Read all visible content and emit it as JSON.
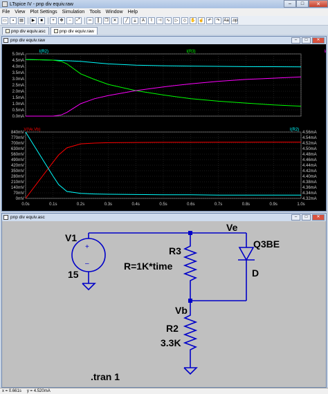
{
  "window": {
    "title": "LTspice IV - pnp div equiv.raw",
    "min": "–",
    "max": "□",
    "close": "✕"
  },
  "menu": [
    "File",
    "View",
    "Plot Settings",
    "Simulation",
    "Tools",
    "Window",
    "Help"
  ],
  "tabs": [
    {
      "label": "pnp div equiv.asc"
    },
    {
      "label": "pnp div equiv.raw"
    }
  ],
  "plot_window": {
    "title": "pnp div equiv.raw",
    "colors": {
      "ir2": "#00ffff",
      "ir3": "#00ff00",
      "iq3be": "#ff00ff",
      "vdiff": "#ff0000",
      "grid": "#3a3a3a",
      "axis_text": "#d0d0d0"
    }
  },
  "chart_data": [
    {
      "type": "line",
      "pane": "top",
      "legend": [
        "I(R2)",
        "I(R3)",
        "I(Q3be)"
      ],
      "y_ticks": [
        "5.0mA",
        "4.5mA",
        "4.0mA",
        "3.5mA",
        "3.0mA",
        "2.5mA",
        "2.0mA",
        "1.5mA",
        "1.0mA",
        "0.5mA",
        "0.0mA"
      ],
      "ylim": [
        0,
        5.0
      ],
      "yunit": "mA",
      "xlim": [
        0,
        1.0
      ],
      "x": [
        0,
        0.05,
        0.1,
        0.13,
        0.15,
        0.2,
        0.25,
        0.3,
        0.4,
        0.5,
        0.6,
        0.7,
        0.8,
        0.9,
        1.0
      ],
      "series": [
        {
          "name": "I(R2)",
          "values": [
            4.55,
            4.53,
            4.5,
            4.47,
            4.45,
            4.4,
            4.3,
            4.2,
            4.1,
            4.05,
            4.02,
            4.0,
            3.98,
            3.97,
            3.96
          ]
        },
        {
          "name": "I(R3)",
          "values": [
            4.55,
            4.53,
            4.5,
            4.4,
            4.2,
            3.4,
            2.95,
            2.55,
            2.05,
            1.7,
            1.4,
            1.2,
            1.05,
            0.9,
            0.8
          ]
        },
        {
          "name": "I(Q3be)",
          "values": [
            0.0,
            0.0,
            0.0,
            0.1,
            0.3,
            1.0,
            1.4,
            1.65,
            2.05,
            2.35,
            2.6,
            2.8,
            2.95,
            3.05,
            3.15
          ]
        }
      ]
    },
    {
      "type": "line",
      "pane": "bottom",
      "legend": [
        "V(Ve,Vb)",
        "I(R2)"
      ],
      "y_ticks_left": [
        "840mV",
        "770mV",
        "700mV",
        "630mV",
        "560mV",
        "490mV",
        "420mV",
        "350mV",
        "280mV",
        "210mV",
        "140mV",
        "70mV",
        "0mV"
      ],
      "y_ticks_right": [
        "4.56mA",
        "4.54mA",
        "4.52mA",
        "4.50mA",
        "4.48mA",
        "4.46mA",
        "4.44mA",
        "4.42mA",
        "4.40mA",
        "4.38mA",
        "4.36mA",
        "4.34mA",
        "4.32mA"
      ],
      "ylim_left": [
        0,
        840
      ],
      "ylim_right": [
        4.32,
        4.56
      ],
      "x_ticks": [
        "0.0s",
        "0.1s",
        "0.2s",
        "0.3s",
        "0.4s",
        "0.5s",
        "0.6s",
        "0.7s",
        "0.8s",
        "0.9s",
        "1.0s"
      ],
      "xlim": [
        0,
        1.0
      ],
      "x": [
        0,
        0.05,
        0.1,
        0.12,
        0.15,
        0.2,
        0.25,
        0.3,
        0.4,
        0.5,
        0.6,
        0.7,
        0.8,
        0.9,
        1.0
      ],
      "series": [
        {
          "name": "V(Ve,Vb)",
          "axis": "left",
          "values": [
            0,
            230,
            460,
            550,
            640,
            690,
            700,
            705,
            708,
            710,
            710,
            711,
            711,
            712,
            712
          ]
        },
        {
          "name": "I(R2)",
          "axis": "right",
          "values": [
            4.56,
            4.48,
            4.4,
            4.37,
            4.345,
            4.338,
            4.336,
            4.335,
            4.334,
            4.333,
            4.333,
            4.332,
            4.332,
            4.332,
            4.332
          ]
        }
      ]
    }
  ],
  "schematic": {
    "title": "pnp div equiv.asc",
    "labels": {
      "v1_name": "V1",
      "v1_value": "15",
      "r3_name": "R3",
      "r3_value": "R=1K*time",
      "vb": "Vb",
      "r2_name": "R2",
      "r2_value": "3.3K",
      "ve": "Ve",
      "d_name": "Q3BE",
      "d_model": "D",
      "directive": ".tran 1"
    },
    "plus": "+",
    "minus": "–"
  },
  "status": {
    "x": "x = 0.661s",
    "y": "y = 4.520mA"
  }
}
